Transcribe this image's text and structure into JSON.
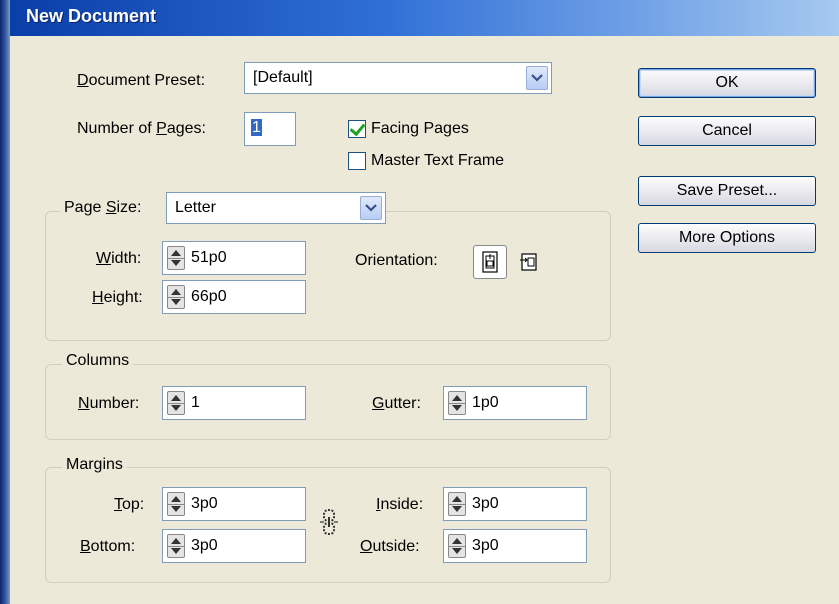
{
  "window": {
    "title": "New Document"
  },
  "preset": {
    "label": "Document Preset:",
    "label_ul": "D",
    "label_rest": "ocument Preset:",
    "value": "[Default]"
  },
  "pages": {
    "label_pre": "Number of ",
    "label_ul": "P",
    "label_post": "ages:",
    "value": "1"
  },
  "facing_pages": {
    "label": "Facing Pages",
    "checked": true
  },
  "master_text_frame": {
    "label": "Master Text Frame",
    "checked": false
  },
  "page_size": {
    "label_pre": "Page ",
    "label_ul": "S",
    "label_post": "ize:",
    "value": "Letter",
    "width": {
      "label_ul": "W",
      "label_post": "idth:",
      "value": "51p0"
    },
    "height": {
      "label_ul": "H",
      "label_post": "eight:",
      "value": "66p0"
    },
    "orientation": {
      "label": "Orientation:",
      "selected": "portrait"
    }
  },
  "columns": {
    "group_label": "Columns",
    "number": {
      "label_ul": "N",
      "label_post": "umber:",
      "value": "1"
    },
    "gutter": {
      "label_ul": "G",
      "label_post": "utter:",
      "value": "1p0"
    }
  },
  "margins": {
    "group_label": "Margins",
    "top": {
      "label_ul": "T",
      "label_post": "op:",
      "value": "3p0"
    },
    "bottom": {
      "label_ul": "B",
      "label_post": "ottom:",
      "value": "3p0"
    },
    "inside": {
      "label_ul": "I",
      "label_post": "nside:",
      "value": "3p0"
    },
    "outside": {
      "label_ul": "O",
      "label_post": "utside:",
      "value": "3p0"
    }
  },
  "buttons": {
    "ok": "OK",
    "cancel": "Cancel",
    "save_preset": "Save Preset...",
    "more_options": "More Options"
  },
  "colors": {
    "title_bar": "#0a3ea8",
    "dialog_bg": "#ece9d8",
    "field_border": "#7f9db9",
    "check": "#21a121"
  },
  "icons": [
    "chevron-down-icon",
    "spinner-icon",
    "portrait-icon",
    "landscape-icon",
    "chain-link-icon"
  ]
}
